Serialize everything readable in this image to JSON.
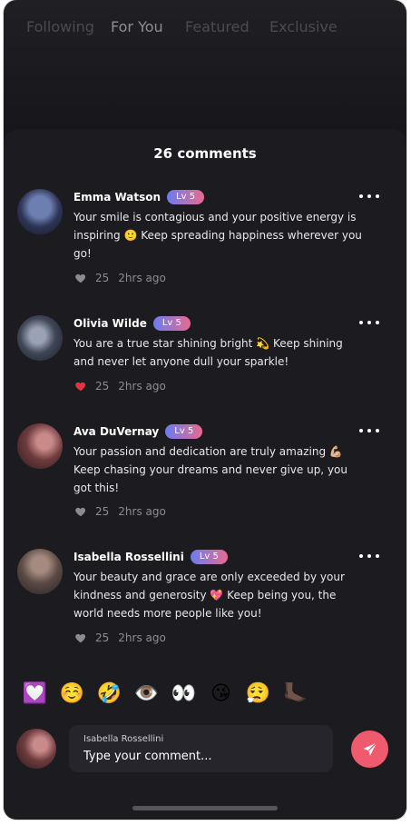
{
  "top_nav": {
    "tabs": [
      "Following",
      "For You",
      "Featured",
      "Exclusive"
    ],
    "active": "For You"
  },
  "comments_panel": {
    "title": "26 comments",
    "comments": [
      {
        "name": "Emma Watson",
        "level": "Lv 5",
        "text": "Your smile is contagious and your positive energy is inspiring 🙂 Keep spreading happiness wherever you go!",
        "likes": "25",
        "time": "2hrs ago",
        "liked": false
      },
      {
        "name": "Olivia Wilde",
        "level": "Lv 5",
        "text": "You are a true star shining bright 💫 Keep shining and never let anyone dull your sparkle!",
        "likes": "25",
        "time": "2hrs ago",
        "liked": true
      },
      {
        "name": "Ava DuVernay",
        "level": "Lv 5",
        "text": "Your passion and dedication are truly amazing 💪🏼 Keep chasing your dreams and never give up, you got this!",
        "likes": "25",
        "time": "2hrs ago",
        "liked": false
      },
      {
        "name": "Isabella Rossellini",
        "level": "Lv 5",
        "text": "Your beauty and grace are only exceeded by your kindness and generosity 💖 Keep being you, the world needs more people like you!",
        "likes": "25",
        "time": "2hrs ago",
        "liked": false
      }
    ]
  },
  "emoji_bar": [
    "💟",
    "☺️",
    "🤣",
    "👁️",
    "👀",
    "😘",
    "😮‍💨",
    "🦶🏿"
  ],
  "composer": {
    "user_name": "Isabella Rossellini",
    "placeholder": "Type your comment..."
  },
  "colors": {
    "accent": "#f05a6e",
    "liked_heart": "#e8323f",
    "level_gradient": [
      "#6b7cf0",
      "#e86a8f"
    ]
  },
  "icons": {
    "more": "more-horizontal-icon",
    "like": "heart-icon",
    "send": "send-icon"
  }
}
